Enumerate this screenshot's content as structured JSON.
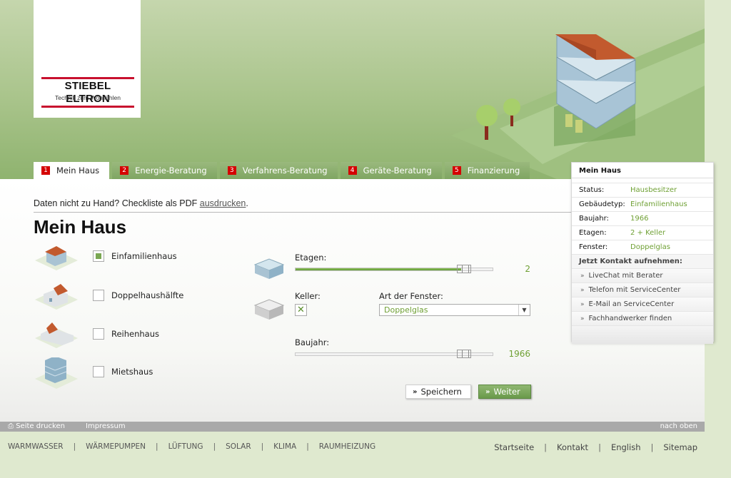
{
  "brand": {
    "name": "STIEBEL ELTRON",
    "tagline": "Technik zum Wohlfühlen"
  },
  "tabs": [
    {
      "num": "1",
      "label": "Mein Haus",
      "active": true
    },
    {
      "num": "2",
      "label": "Energie-Beratung"
    },
    {
      "num": "3",
      "label": "Verfahrens-Beratung"
    },
    {
      "num": "4",
      "label": "Geräte-Beratung"
    },
    {
      "num": "5",
      "label": "Finanzierung"
    }
  ],
  "main": {
    "hint_prefix": "Daten nicht zu Hand? Checkliste als PDF ",
    "hint_link": "ausdrucken",
    "hint_suffix": ".",
    "title": "Mein Haus",
    "house_types": [
      {
        "label": "Einfamilienhaus",
        "checked": true,
        "icon": "detached-house-icon"
      },
      {
        "label": "Doppelhaushälfte",
        "checked": false,
        "icon": "semi-detached-house-icon"
      },
      {
        "label": "Reihenhaus",
        "checked": false,
        "icon": "terraced-house-icon"
      },
      {
        "label": "Mietshaus",
        "checked": false,
        "icon": "apartment-building-icon"
      }
    ],
    "etagen": {
      "label": "Etagen:",
      "value": "2",
      "fill_fraction": 0.42
    },
    "keller": {
      "label": "Keller:",
      "checked": true
    },
    "fenster": {
      "label": "Art der Fenster:",
      "value": "Doppelglas"
    },
    "baujahr": {
      "label": "Baujahr:",
      "value": "1966",
      "fill_fraction": 0.42
    },
    "save_label": "Speichern",
    "next_label": "Weiter"
  },
  "side": {
    "title": "Mein Haus",
    "rows": [
      {
        "key": "Status:",
        "value": "Hausbesitzer"
      },
      {
        "key": "Gebäudetyp:",
        "value": "Einfamilienhaus"
      },
      {
        "key": "Baujahr:",
        "value": "1966"
      },
      {
        "key": "Etagen:",
        "value": "2 + Keller"
      },
      {
        "key": "Fenster:",
        "value": "Doppelglas"
      }
    ],
    "contact_title": "Jetzt Kontakt aufnehmen:",
    "links": [
      "LiveChat mit Berater",
      "Telefon mit ServiceCenter",
      "E-Mail an ServiceCenter",
      "Fachhandwerker finden"
    ]
  },
  "bar": {
    "print": "Seite drucken",
    "impressum": "Impressum",
    "top": "nach oben"
  },
  "bottom_nav": [
    "WARMWASSER",
    "WÄRMEPUMPEN",
    "LÜFTUNG",
    "SOLAR",
    "KLIMA",
    "RAUMHEIZUNG"
  ],
  "meta_nav": [
    "Startseite",
    "Kontakt",
    "English",
    "Sitemap"
  ],
  "colors": {
    "accent_green": "#6fa034",
    "tab_green": "#8cb06f",
    "brand_red": "#c8102e"
  }
}
